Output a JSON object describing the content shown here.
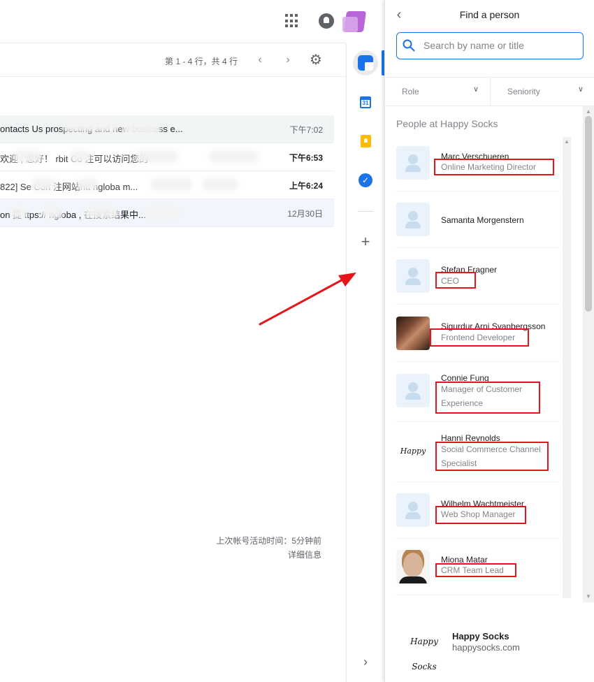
{
  "gmail": {
    "pager": "第 1 - 4 行，共 4 行",
    "rows": [
      {
        "snippet": "ontacts Us       prospecting          and new business e...",
        "time": "下午7:02",
        "unread": false
      },
      {
        "snippet": "欢迎        , 您好！       rbit Co          注可以访问您的",
        "time": "下午6:53",
        "unread": true
      },
      {
        "snippet": "822] Se       Con       注网站htt           ngloba            m...",
        "time": "上午6:24",
        "unread": true
      },
      {
        "snippet": "on       提     ttps://        ngloba             , 在搜索结果中...",
        "time": "12月30日",
        "unread": false
      }
    ],
    "activity_line1": "上次帐号活动时间：5分钟前",
    "activity_line2": "详细信息"
  },
  "side_strip": {
    "calendar_day": "31"
  },
  "panel": {
    "title": "Find a person",
    "search_placeholder": "Search by name or title",
    "filters": [
      "Role",
      "Seniority"
    ],
    "section_title": "People at Happy Socks",
    "people": [
      {
        "name": "Marc Verschueren",
        "title": "Online Marketing Director",
        "pic": "default"
      },
      {
        "name": "Samanta Morgenstern",
        "title": "",
        "pic": "default"
      },
      {
        "name": "Stefan Fragner",
        "title": "CEO",
        "pic": "default"
      },
      {
        "name": "Sigurdur Arni Svanbergsson",
        "title": "Frontend Developer",
        "pic": "photo-m"
      },
      {
        "name": "Connie Fung",
        "title": "Manager of Customer Experience",
        "pic": "default"
      },
      {
        "name": "Hanni Reynolds",
        "title": "Social Commerce Channel Specialist",
        "pic": "logo"
      },
      {
        "name": "Wilhelm Wachtmeister",
        "title": "Web Shop Manager",
        "pic": "default"
      },
      {
        "name": "Miona Matar",
        "title": "CRM Team Lead",
        "pic": "photo-f"
      }
    ],
    "logo_text": "Happy Socks",
    "company": {
      "name": "Happy Socks",
      "url": "happysocks.com"
    }
  },
  "colors": {
    "accent": "#1a73e8",
    "annotation_red": "#e4161b"
  }
}
